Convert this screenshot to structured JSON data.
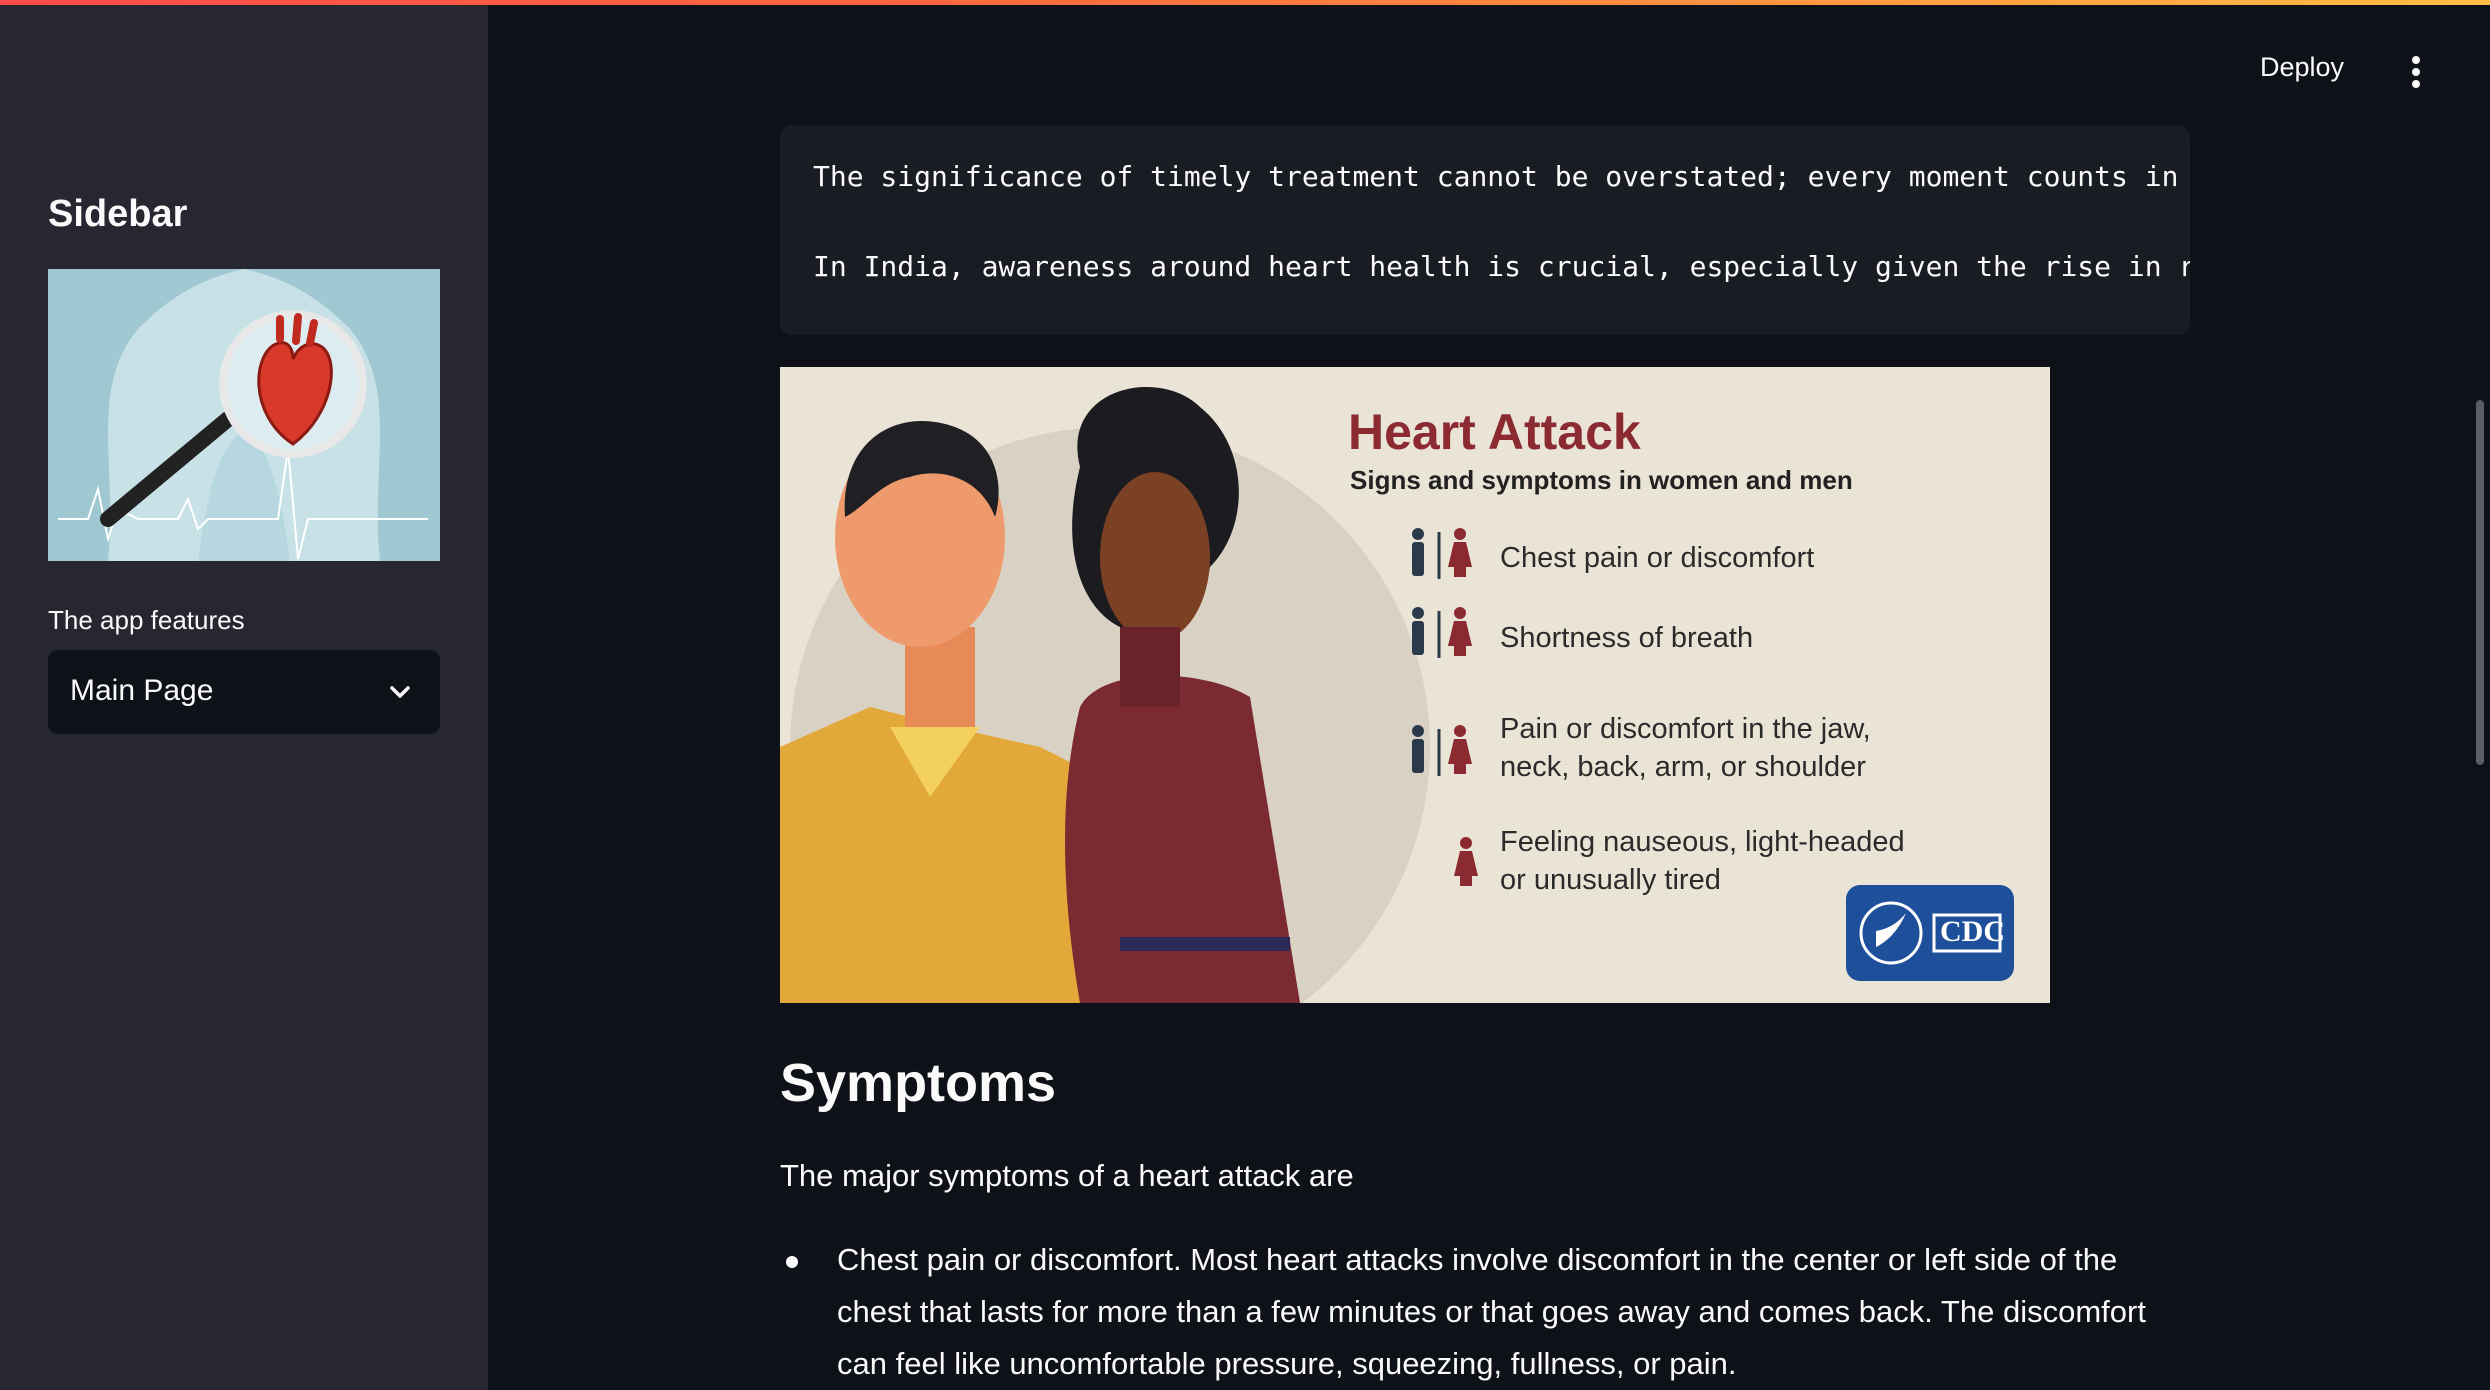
{
  "header": {
    "deploy_label": "Deploy"
  },
  "sidebar": {
    "title": "Sidebar",
    "feature_label": "The app features",
    "select_value": "Main Page"
  },
  "main": {
    "code_lines": [
      "The significance of timely treatment cannot be overstated; every moment counts in",
      "In India, awareness around heart health is crucial, especially given the rise in r"
    ],
    "infographic": {
      "title": "Heart Attack",
      "subtitle": "Signs and symptoms in women and men",
      "symptoms": [
        "Chest pain or discomfort",
        "Shortness of breath",
        "Pain or discomfort in the jaw,\nneck, back, arm, or shoulder",
        "Feeling nauseous, light-headed\nor unusually tired"
      ],
      "badge": "CDC"
    },
    "section_heading": "Symptoms",
    "intro": "The major symptoms of a heart attack are",
    "bullets": [
      "Chest pain or discomfort. Most heart attacks involve discomfort in the center or left side of the chest that lasts for more than a few minutes or that goes away and comes back. The discomfort can feel like uncomfortable pressure, squeezing, fullness, or pain."
    ]
  },
  "colors": {
    "background": "#0e1117",
    "sidebar": "#262730",
    "code_block": "#1a1c24",
    "heading_red": "#8b2a30",
    "cdc_blue": "#1e4f9a"
  }
}
